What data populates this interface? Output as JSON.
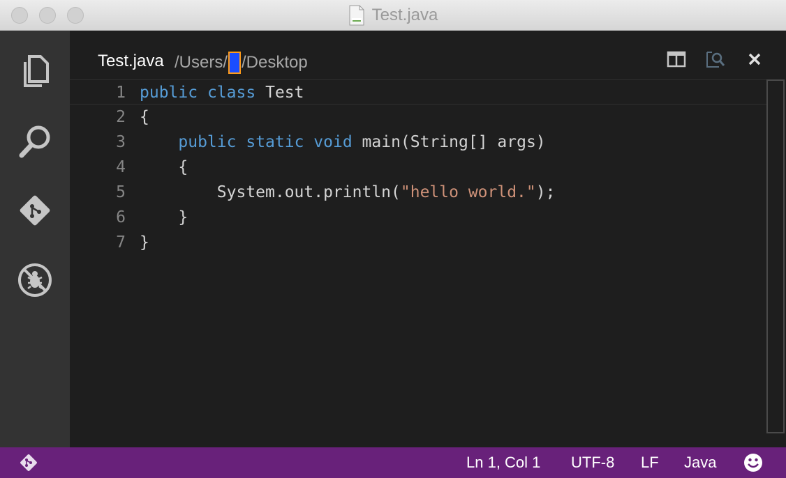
{
  "window": {
    "title": "Test.java"
  },
  "activity_bar": {
    "items": [
      {
        "name": "explorer",
        "icon": "files-icon"
      },
      {
        "name": "search",
        "icon": "search-icon"
      },
      {
        "name": "git",
        "icon": "git-icon"
      },
      {
        "name": "debug",
        "icon": "debug-icon"
      }
    ]
  },
  "editor": {
    "file_name": "Test.java",
    "path_prefix": "/Users/",
    "path_suffix": "/Desktop",
    "lines": [
      {
        "number": "1"
      },
      {
        "number": "2"
      },
      {
        "number": "3"
      },
      {
        "number": "4"
      },
      {
        "number": "5"
      },
      {
        "number": "6"
      },
      {
        "number": "7"
      }
    ],
    "tokens": {
      "l1_kw1": "public",
      "l1_kw2": "class",
      "l1_rest": "Test",
      "l2": "{",
      "l3_kw1": "public",
      "l3_kw2": "static",
      "l3_kw3": "void",
      "l3_rest": "main(String[] args)",
      "l4": "{",
      "l5_pre": "System.out.println(",
      "l5_str": "\"hello world.\"",
      "l5_post": ");",
      "l6": "}",
      "l7": "}"
    }
  },
  "status_bar": {
    "position": "Ln 1, Col 1",
    "encoding": "UTF-8",
    "eol": "LF",
    "language": "Java"
  },
  "colors": {
    "status_bar": "#68217a",
    "keyword": "#569cd6",
    "string": "#ce9178",
    "activity_bar": "#333333",
    "editor_bg": "#1e1e1e"
  }
}
